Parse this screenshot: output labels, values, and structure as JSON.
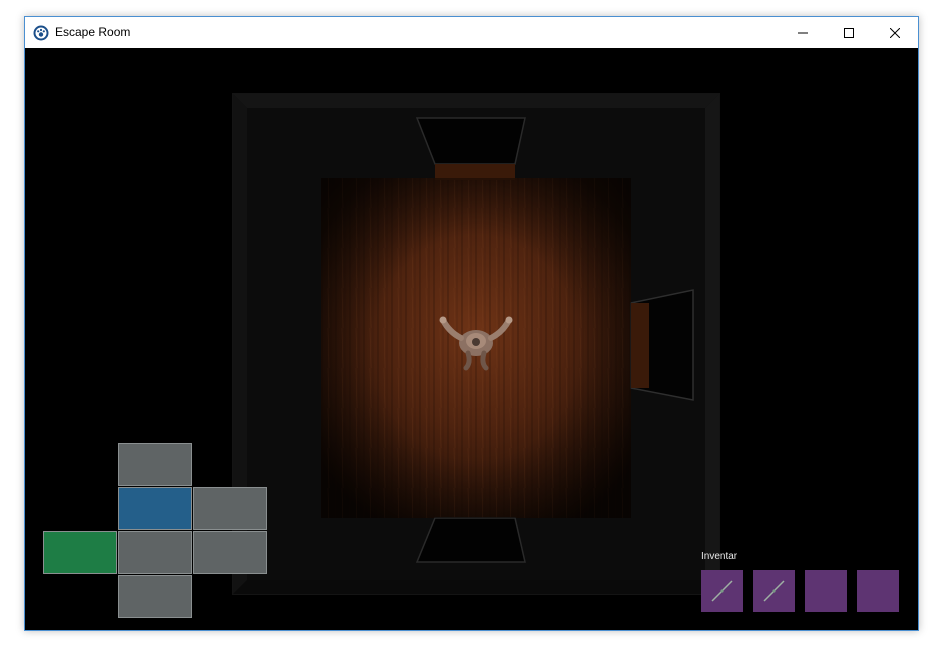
{
  "window": {
    "title": "Escape Room",
    "controls": [
      "minimize-icon",
      "maximize-icon",
      "close-icon"
    ]
  },
  "minimap": {
    "cells": [
      {
        "col": 1,
        "row": 0,
        "state": "unvisited"
      },
      {
        "col": 1,
        "row": 1,
        "state": "current"
      },
      {
        "col": 2,
        "row": 1,
        "state": "unvisited"
      },
      {
        "col": 0,
        "row": 2,
        "state": "exit"
      },
      {
        "col": 1,
        "row": 2,
        "state": "unvisited"
      },
      {
        "col": 2,
        "row": 2,
        "state": "unvisited"
      },
      {
        "col": 1,
        "row": 3,
        "state": "unvisited"
      }
    ],
    "colors": {
      "unvisited": "#5f6465",
      "current": "#245f8a",
      "exit": "#1e7d45"
    }
  },
  "inventory": {
    "label": "Inventar",
    "slots": [
      {
        "item": "wand-icon"
      },
      {
        "item": "wand-icon"
      },
      {
        "item": ""
      },
      {
        "item": ""
      }
    ],
    "slot_color": "#5e3472"
  }
}
